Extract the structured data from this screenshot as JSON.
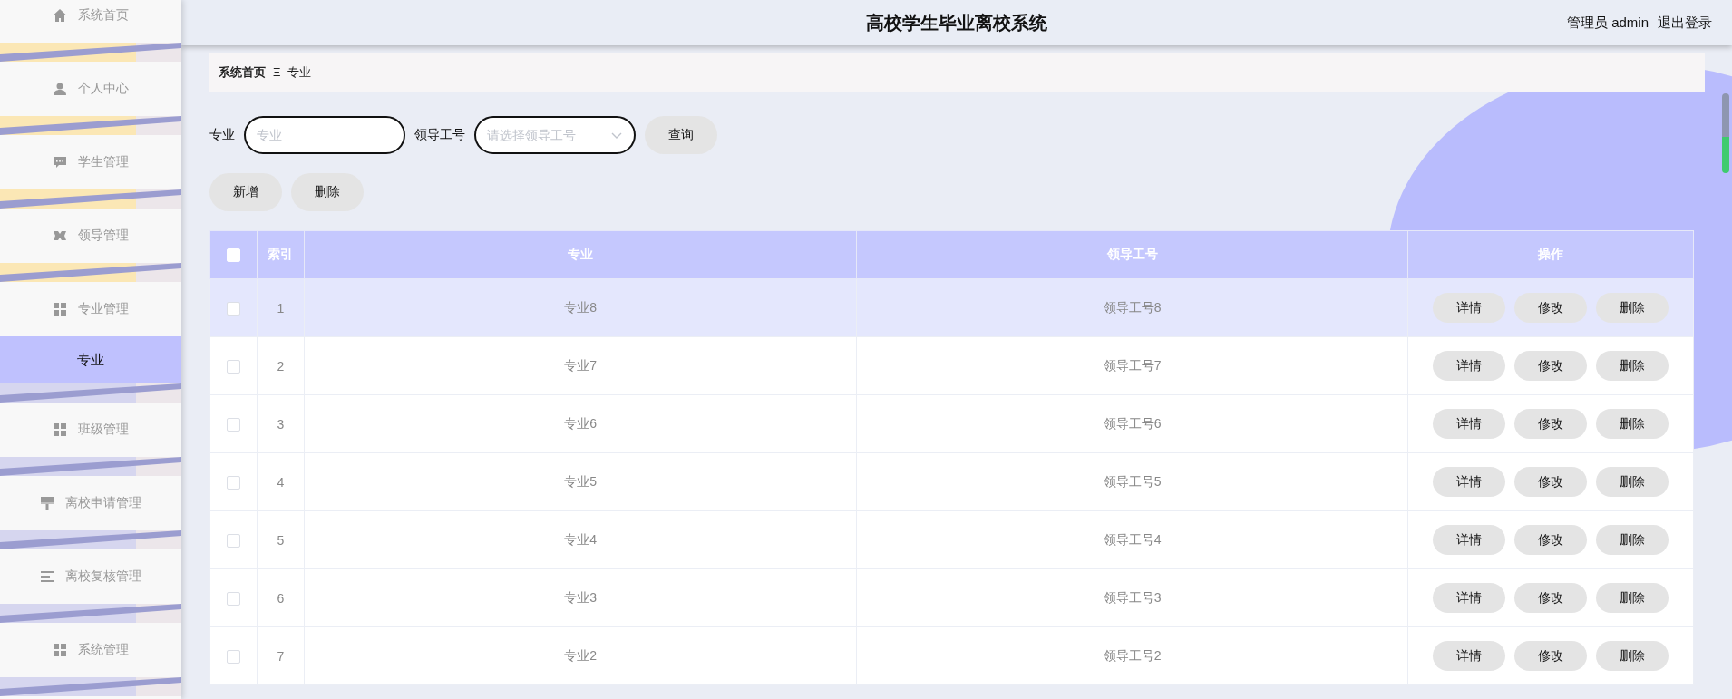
{
  "sidebar": {
    "items": [
      {
        "label": "系统首页",
        "kind": "menu",
        "selected": false
      },
      {
        "label": "个人中心",
        "kind": "menu",
        "selected": false
      },
      {
        "label": "学生管理",
        "kind": "menu",
        "selected": false
      },
      {
        "label": "领导管理",
        "kind": "menu",
        "selected": false
      },
      {
        "label": "专业管理",
        "kind": "menu",
        "selected": false
      },
      {
        "label": "专业",
        "kind": "submenu",
        "selected": true
      },
      {
        "label": "班级管理",
        "kind": "menu",
        "selected": false
      },
      {
        "label": "离校申请管理",
        "kind": "menu",
        "selected": false
      },
      {
        "label": "离校复核管理",
        "kind": "menu",
        "selected": false
      },
      {
        "label": "系统管理",
        "kind": "menu",
        "selected": false
      }
    ]
  },
  "header": {
    "title": "高校学生毕业离校系统",
    "user": "管理员 admin",
    "logout": "退出登录"
  },
  "breadcrumb": {
    "items": [
      "系统首页",
      "专业"
    ],
    "separator": "Ξ"
  },
  "search": {
    "fields": [
      {
        "label": "专业",
        "placeholder": "专业",
        "kind": "input"
      },
      {
        "label": "领导工号",
        "placeholder": "请选择领导工号",
        "kind": "select"
      }
    ],
    "button": "查询"
  },
  "actions": [
    "新增",
    "删除"
  ],
  "table": {
    "select_all": {
      "checked": false
    },
    "columns": [
      "索引",
      "专业",
      "领导工号",
      "操作"
    ],
    "rows": [
      {
        "index": "1",
        "major": "专业8",
        "leader_id": "领导工号8",
        "checked": false,
        "highlighted": true,
        "buttons": [
          "详情",
          "修改",
          "删除"
        ]
      },
      {
        "index": "2",
        "major": "专业7",
        "leader_id": "领导工号7",
        "checked": false,
        "highlighted": false,
        "buttons": [
          "详情",
          "修改",
          "删除"
        ]
      },
      {
        "index": "3",
        "major": "专业6",
        "leader_id": "领导工号6",
        "checked": false,
        "highlighted": false,
        "buttons": [
          "详情",
          "修改",
          "删除"
        ]
      },
      {
        "index": "4",
        "major": "专业5",
        "leader_id": "领导工号5",
        "checked": false,
        "highlighted": false,
        "buttons": [
          "详情",
          "修改",
          "删除"
        ]
      },
      {
        "index": "5",
        "major": "专业4",
        "leader_id": "领导工号4",
        "checked": false,
        "highlighted": false,
        "buttons": [
          "详情",
          "修改",
          "删除"
        ]
      },
      {
        "index": "6",
        "major": "专业3",
        "leader_id": "领导工号3",
        "checked": false,
        "highlighted": false,
        "buttons": [
          "详情",
          "修改",
          "删除"
        ]
      },
      {
        "index": "7",
        "major": "专业2",
        "leader_id": "领导工号2",
        "checked": false,
        "highlighted": false,
        "buttons": [
          "详情",
          "修改",
          "删除"
        ]
      }
    ]
  }
}
